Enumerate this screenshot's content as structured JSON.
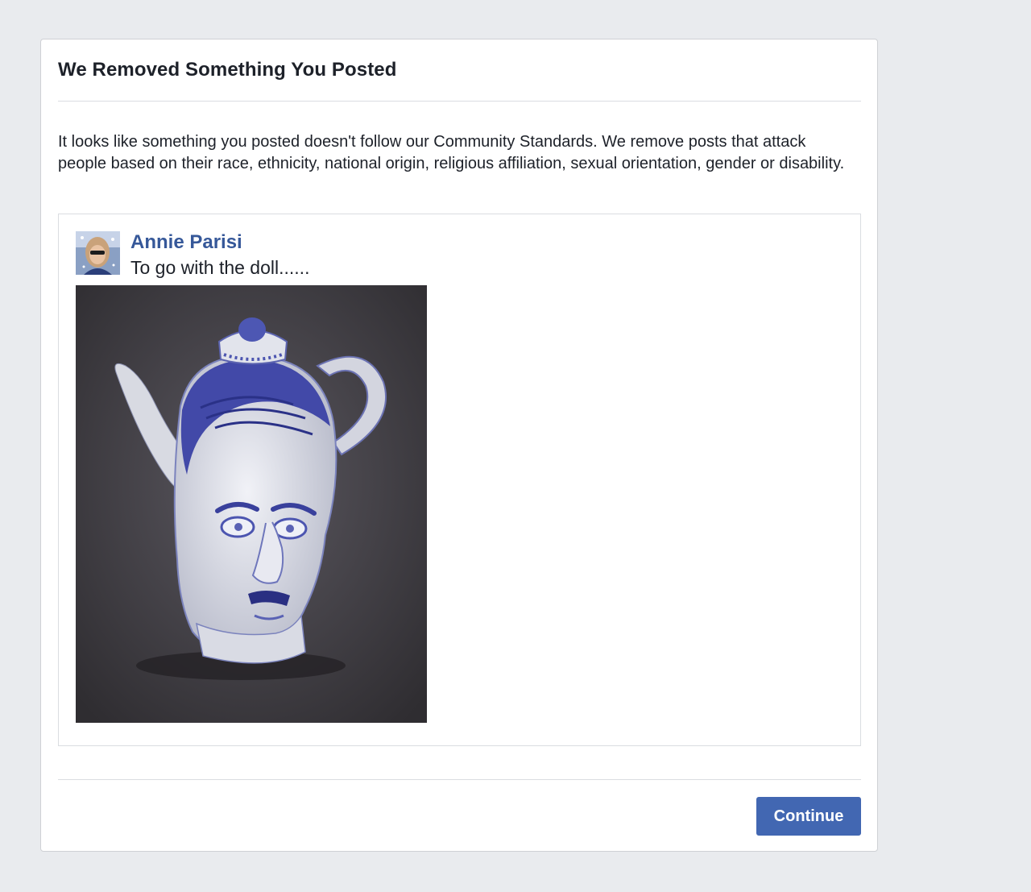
{
  "dialog": {
    "title": "We Removed Something You Posted",
    "message": "It looks like something you posted doesn't follow our Community Standards. We remove posts that attack people based on their race, ethnicity, national origin, religious affiliation, sexual orientation, gender or disability."
  },
  "post": {
    "author": "Annie Parisi",
    "text": "To go with the doll......",
    "image_icon": "photo-icon",
    "avatar_icon": "avatar-icon"
  },
  "footer": {
    "continue_label": "Continue"
  },
  "colors": {
    "background": "#e9ebee",
    "link": "#365899",
    "button": "#4267b2"
  }
}
